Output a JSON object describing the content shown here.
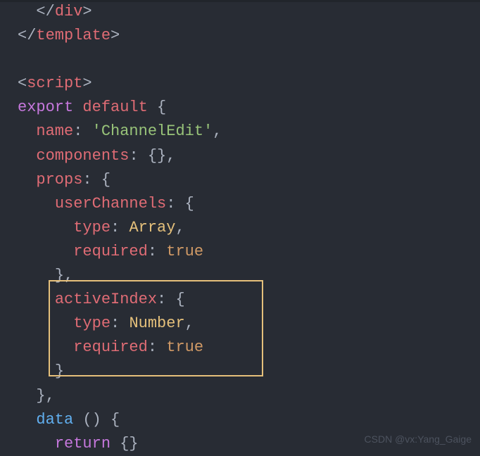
{
  "code": {
    "line1_close": "</",
    "line1_tag": "div",
    "line1_end": ">",
    "line2_close": "</",
    "line2_tag": "template",
    "line2_end": ">",
    "line4_open": "<",
    "line4_tag": "script",
    "line4_end": ">",
    "line5_export": "export",
    "line5_default": "default",
    "line5_brace": " {",
    "line6_prop": "name",
    "line6_colon": ": ",
    "line6_value": "'ChannelEdit'",
    "line6_comma": ",",
    "line7_prop": "components",
    "line7_rest": ": {},",
    "line8_prop": "props",
    "line8_rest": ": {",
    "line9_prop": "userChannels",
    "line9_rest": ": {",
    "line10_prop": "type",
    "line10_colon": ": ",
    "line10_value": "Array",
    "line10_comma": ",",
    "line11_prop": "required",
    "line11_colon": ": ",
    "line11_value": "true",
    "line12_text": "},",
    "line13_prop": "activeIndex",
    "line13_rest": ": {",
    "line14_prop": "type",
    "line14_colon": ": ",
    "line14_value": "Number",
    "line14_comma": ",",
    "line15_prop": "required",
    "line15_colon": ": ",
    "line15_value": "true",
    "line16_text": "}",
    "line17_text": "},",
    "line18_prop": "data",
    "line18_rest": " () {",
    "line19_keyword": "return",
    "line19_rest": " {}"
  },
  "watermark": "CSDN @vx:Yang_Gaige"
}
